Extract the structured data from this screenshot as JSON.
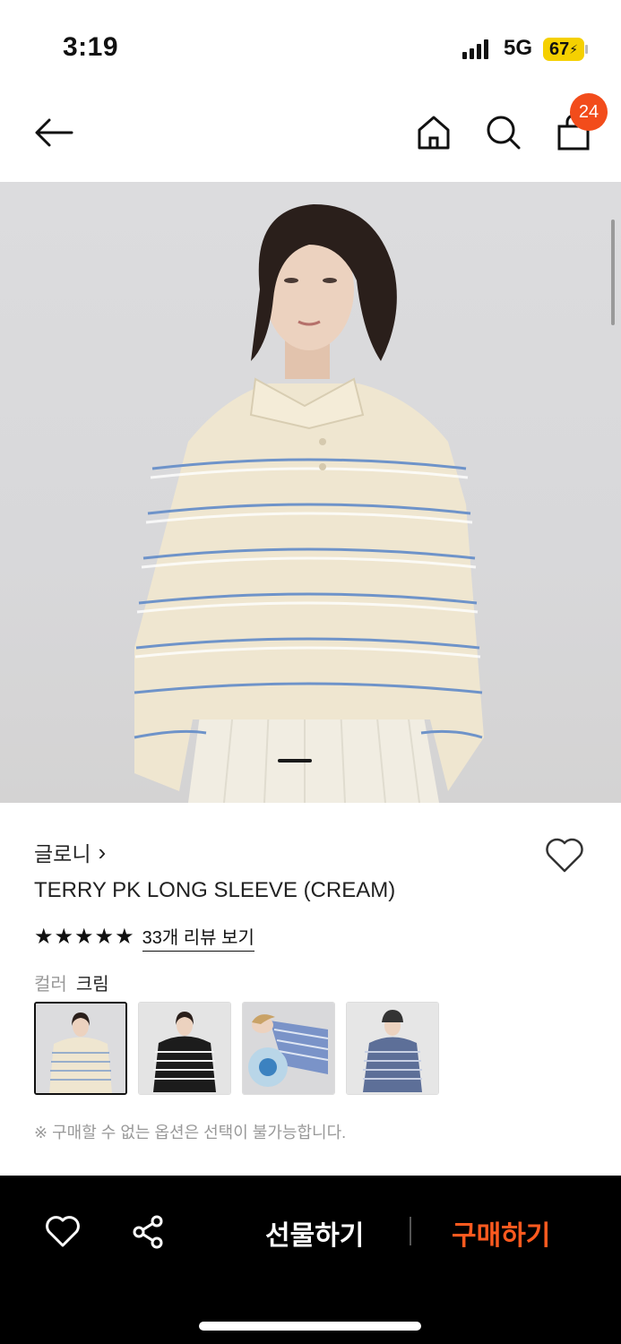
{
  "status": {
    "time": "3:19",
    "network": "5G",
    "battery": "67"
  },
  "nav": {
    "cart_count": "24"
  },
  "product": {
    "brand": "글로니",
    "brand_chevron": "›",
    "name": "TERRY PK LONG SLEEVE (CREAM)",
    "rating_stars": 5,
    "review_link": "33개 리뷰 보기",
    "color_label": "컬러",
    "color_value": "크림",
    "notice": "※ 구매할 수 없는 옵션은 선택이 불가능합니다."
  },
  "bottom": {
    "gift_label": "선물하기",
    "buy_label": "구매하기"
  },
  "colors": {
    "accent": "#ff5a1f",
    "badge": "#f24c1b"
  },
  "icons": [
    "back-arrow-icon",
    "home-icon",
    "search-icon",
    "shopping-bag-icon",
    "heart-icon",
    "share-icon"
  ]
}
